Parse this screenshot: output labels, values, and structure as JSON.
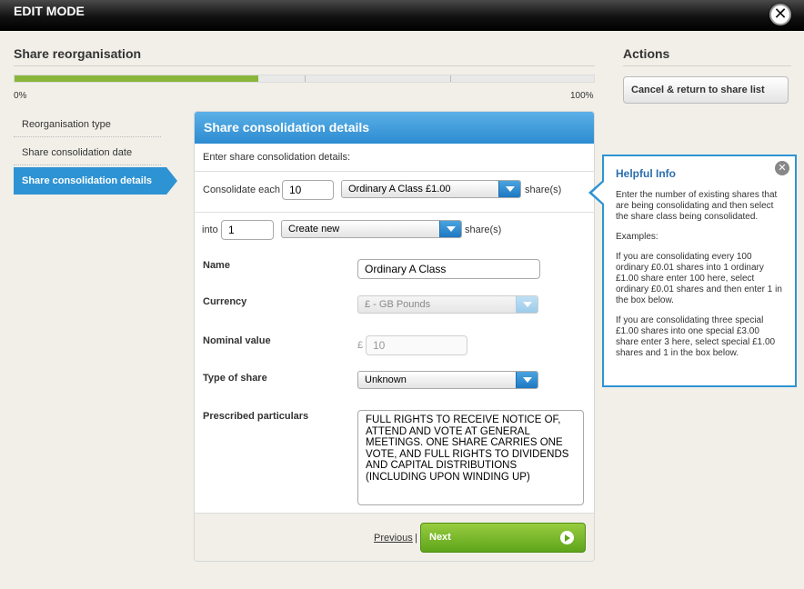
{
  "topbar": {
    "title": "EDIT MODE",
    "close_label": "✕"
  },
  "section": {
    "title": "Share reorganisation",
    "progress": {
      "fraction": 0.42,
      "start_label": "0%",
      "end_label": "100%"
    }
  },
  "actions": {
    "title": "Actions",
    "cancel_label": "Cancel & return to share list"
  },
  "steps": [
    {
      "label": "Reorganisation type",
      "active": false
    },
    {
      "label": "Share consolidation date",
      "active": false
    },
    {
      "label": "Share consolidation details",
      "active": true
    }
  ],
  "form": {
    "title": "Share consolidation details",
    "intro": "Enter share consolidation details:",
    "consolidate_label": "Consolidate each",
    "consolidate_value": "10",
    "share_class": "Ordinary A Class £1.00",
    "shares_suffix": "share(s)",
    "into_label": "into",
    "into_value": "1",
    "into_option": "Create new",
    "name_label": "Name",
    "name_value": "Ordinary A Class",
    "currency_label": "Currency",
    "currency_value": "£ - GB Pounds",
    "nominal_label": "Nominal value",
    "nominal_currency": "£",
    "nominal_value": "10",
    "type_label": "Type of share",
    "type_value": "Unknown",
    "particulars_label": "Prescribed particulars",
    "particulars_value": "FULL RIGHTS TO RECEIVE NOTICE OF, ATTEND AND VOTE AT GENERAL MEETINGS. ONE SHARE CARRIES ONE VOTE, AND FULL RIGHTS TO DIVIDENDS AND CAPITAL DISTRIBUTIONS (INCLUDING UPON WINDING UP)",
    "previous_label": "Previous",
    "separator": "|",
    "next_label": "Next"
  },
  "help": {
    "title": "Helpful Info",
    "close_label": "✕",
    "p1": "Enter the number of existing shares that are being consolidating and then select the share class being consolidated.",
    "p2": "Examples:",
    "p3": "If you are consolidating every 100 ordinary £0.01 shares into 1 ordinary £1.00 share enter 100 here, select ordinary £0.01 shares and then enter 1 in the box below.",
    "p4": "If you are consolidating three special £1.00 shares into one special £3.00 share enter 3 here, select special £1.00 shares and 1 in the box below."
  },
  "colors": {
    "accent": "#2e93d3",
    "progress": "#8ab53b",
    "next": "#6fb22a"
  }
}
